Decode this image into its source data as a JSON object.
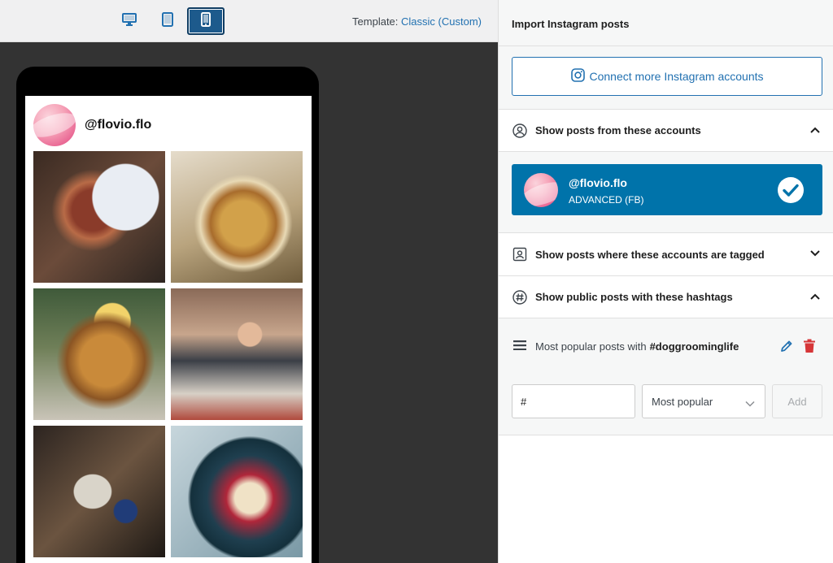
{
  "toolbar": {
    "devices": [
      {
        "name": "desktop",
        "icon": "desktop-icon",
        "active": false
      },
      {
        "name": "tablet",
        "icon": "tablet-icon",
        "active": false
      },
      {
        "name": "mobile",
        "icon": "mobile-icon",
        "active": true
      }
    ],
    "template_label": "Template:",
    "template_value": "Classic (Custom)"
  },
  "preview": {
    "handle": "@flovio.flo",
    "posts": [
      {
        "subject": "steak dinner plate"
      },
      {
        "subject": "chickpea bowl"
      },
      {
        "subject": "pancake stack with lemon"
      },
      {
        "subject": "woman rolling dough in kitchen"
      },
      {
        "subject": "flour jar and eggs"
      },
      {
        "subject": "ravioli on blue plate"
      }
    ]
  },
  "panel": {
    "title": "Import Instagram posts",
    "connect_label": "Connect more Instagram accounts",
    "sections": {
      "accounts": {
        "label": "Show posts from these accounts",
        "expanded": true,
        "account": {
          "name": "@flovio.flo",
          "type": "ADVANCED (FB)",
          "selected": true
        }
      },
      "tagged": {
        "label": "Show posts where these accounts are tagged",
        "expanded": false
      },
      "hashtags": {
        "label": "Show public posts with these hashtags",
        "expanded": true,
        "item_prefix": "Most popular posts with",
        "item_tag": "#doggroominglife",
        "input_value": "#",
        "order_value": "Most popular",
        "add_label": "Add"
      }
    }
  },
  "colors": {
    "accent": "#0073aa",
    "link": "#2271b1",
    "preview_bg": "#333333",
    "danger": "#d63638"
  }
}
